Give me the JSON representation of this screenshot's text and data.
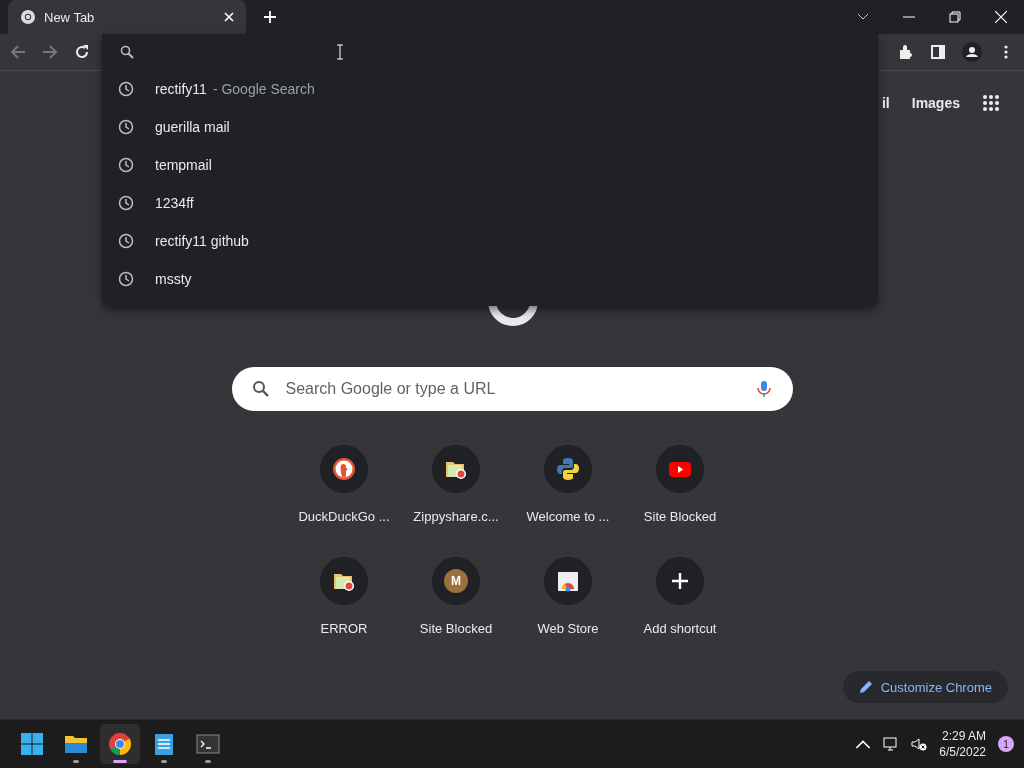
{
  "tab": {
    "title": "New Tab",
    "selected": true
  },
  "omnibox": {
    "suggestions": [
      {
        "text": "rectify11",
        "detail": "- Google Search"
      },
      {
        "text": "guerilla mail"
      },
      {
        "text": "tempmail"
      },
      {
        "text": "1234ff"
      },
      {
        "text": "rectify11 github"
      },
      {
        "text": "mssty"
      }
    ]
  },
  "header_links": [
    "il",
    "Images"
  ],
  "search": {
    "placeholder": "Search Google or type a URL"
  },
  "shortcuts": [
    {
      "label": "DuckDuckGo ...",
      "kind": "duck"
    },
    {
      "label": "Zippyshare.c...",
      "kind": "folder"
    },
    {
      "label": "Welcome to ...",
      "kind": "python"
    },
    {
      "label": "Site Blocked",
      "kind": "play"
    },
    {
      "label": "ERROR",
      "kind": "folder"
    },
    {
      "label": "Site Blocked",
      "kind": "letter",
      "letter": "M"
    },
    {
      "label": "Web Store",
      "kind": "store"
    },
    {
      "label": "Add shortcut",
      "kind": "add"
    }
  ],
  "customize_button": "Customize Chrome",
  "taskbar": {
    "apps": [
      {
        "kind": "start",
        "running": false,
        "selected": false
      },
      {
        "kind": "explorer",
        "running": true,
        "selected": false
      },
      {
        "kind": "chrome",
        "running": true,
        "selected": true
      },
      {
        "kind": "notepad",
        "running": true,
        "selected": false
      },
      {
        "kind": "terminal",
        "running": true,
        "selected": false
      }
    ],
    "time": "2:29 AM",
    "date": "6/5/2022",
    "notification_count": "1"
  }
}
